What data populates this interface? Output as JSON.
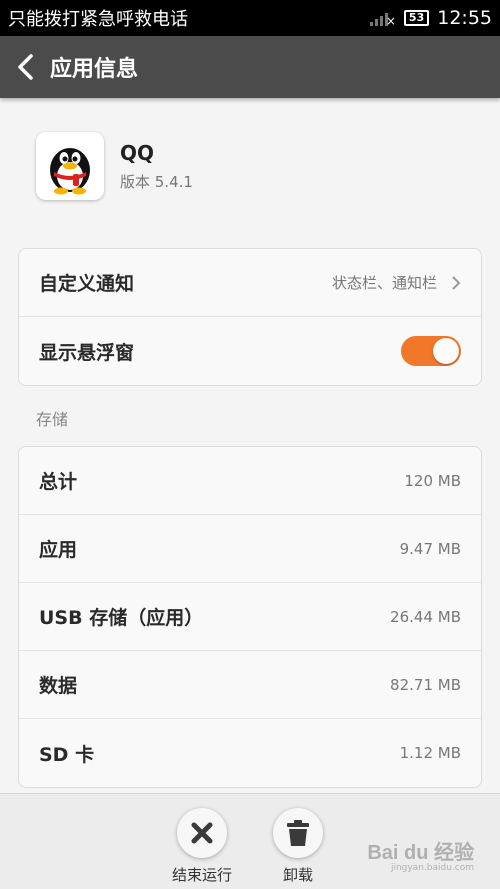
{
  "status_bar": {
    "text": "只能拨打紧急呼救电话",
    "battery": "53",
    "time": "12:55"
  },
  "action_bar": {
    "title": "应用信息"
  },
  "app": {
    "name": "QQ",
    "version": "版本 5.4.1"
  },
  "settings": {
    "notification": {
      "label": "自定义通知",
      "value": "状态栏、通知栏"
    },
    "floating_window": {
      "label": "显示悬浮窗",
      "enabled": true
    }
  },
  "storage": {
    "section_label": "存储",
    "rows": [
      {
        "label": "总计",
        "value": "120 MB"
      },
      {
        "label": "应用",
        "value": "9.47 MB"
      },
      {
        "label": "USB 存储（应用）",
        "value": "26.44 MB"
      },
      {
        "label": "数据",
        "value": "82.71 MB"
      },
      {
        "label": "SD 卡",
        "value": "1.12 MB"
      }
    ]
  },
  "bottom_bar": {
    "force_stop": "结束运行",
    "uninstall": "卸载"
  },
  "watermark": {
    "logo": "Bai du 经验",
    "url": "jingyan.baidu.com"
  },
  "colors": {
    "toggle_on": "#f07828",
    "action_bar": "#4b4b4b"
  }
}
